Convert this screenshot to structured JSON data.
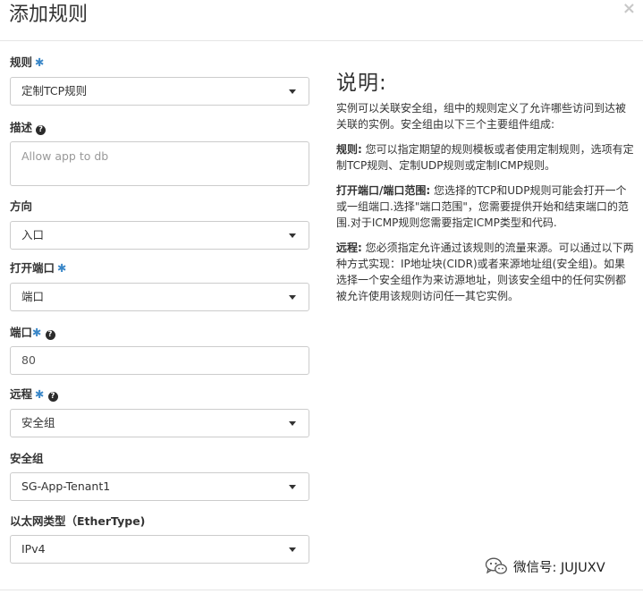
{
  "dialog": {
    "title": "添加规则",
    "close_glyph": "×"
  },
  "form": {
    "rule": {
      "label": "规则",
      "required": "✱",
      "value": "定制TCP规则"
    },
    "description": {
      "label": "描述",
      "help_glyph": "?",
      "placeholder": "Allow app to db"
    },
    "direction": {
      "label": "方向",
      "value": "入口"
    },
    "open_port": {
      "label": "打开端口",
      "required": "✱",
      "value": "端口"
    },
    "port": {
      "label": "端口",
      "required": "✱",
      "help_glyph": "?",
      "value": "80"
    },
    "remote": {
      "label": "远程",
      "required": "✱",
      "help_glyph": "?",
      "value": "安全组"
    },
    "security_group": {
      "label": "安全组",
      "value": "SG-App-Tenant1"
    },
    "ether_type": {
      "label": "以太网类型（EtherType)",
      "value": "IPv4"
    }
  },
  "help_panel": {
    "title": "说明:",
    "intro": "实例可以关联安全组，组中的规则定义了允许哪些访问到达被关联的实例。安全组由以下三个主要组件组成:",
    "rule_term": "规则:",
    "rule_text": "您可以指定期望的规则模板或者使用定制规则，选项有定制TCP规则、定制UDP规则或定制ICMP规则。",
    "port_term": "打开端口/端口范围:",
    "port_text": "您选择的TCP和UDP规则可能会打开一个或一组端口.选择\"端口范围\"，您需要提供开始和结束端口的范围.对于ICMP规则您需要指定ICMP类型和代码.",
    "remote_term": "远程:",
    "remote_text": "您必须指定允许通过该规则的流量来源。可以通过以下两种方式实现：IP地址块(CIDR)或者来源地址组(安全组)。如果选择一个安全组作为来访源地址，则该安全组中的任何实例都被允许使用该规则访问任一其它实例。"
  },
  "watermark": {
    "icon": "wechat-icon",
    "text": "微信号: JUJUXV"
  }
}
